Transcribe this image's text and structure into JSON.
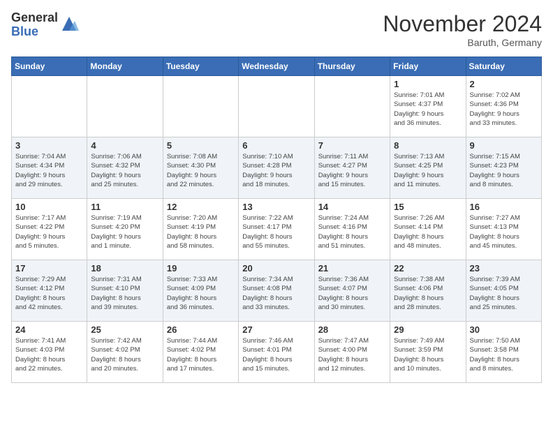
{
  "logo": {
    "general": "General",
    "blue": "Blue"
  },
  "title": "November 2024",
  "location": "Baruth, Germany",
  "days_of_week": [
    "Sunday",
    "Monday",
    "Tuesday",
    "Wednesday",
    "Thursday",
    "Friday",
    "Saturday"
  ],
  "weeks": [
    [
      {
        "day": "",
        "info": ""
      },
      {
        "day": "",
        "info": ""
      },
      {
        "day": "",
        "info": ""
      },
      {
        "day": "",
        "info": ""
      },
      {
        "day": "",
        "info": ""
      },
      {
        "day": "1",
        "info": "Sunrise: 7:01 AM\nSunset: 4:37 PM\nDaylight: 9 hours\nand 36 minutes."
      },
      {
        "day": "2",
        "info": "Sunrise: 7:02 AM\nSunset: 4:36 PM\nDaylight: 9 hours\nand 33 minutes."
      }
    ],
    [
      {
        "day": "3",
        "info": "Sunrise: 7:04 AM\nSunset: 4:34 PM\nDaylight: 9 hours\nand 29 minutes."
      },
      {
        "day": "4",
        "info": "Sunrise: 7:06 AM\nSunset: 4:32 PM\nDaylight: 9 hours\nand 25 minutes."
      },
      {
        "day": "5",
        "info": "Sunrise: 7:08 AM\nSunset: 4:30 PM\nDaylight: 9 hours\nand 22 minutes."
      },
      {
        "day": "6",
        "info": "Sunrise: 7:10 AM\nSunset: 4:28 PM\nDaylight: 9 hours\nand 18 minutes."
      },
      {
        "day": "7",
        "info": "Sunrise: 7:11 AM\nSunset: 4:27 PM\nDaylight: 9 hours\nand 15 minutes."
      },
      {
        "day": "8",
        "info": "Sunrise: 7:13 AM\nSunset: 4:25 PM\nDaylight: 9 hours\nand 11 minutes."
      },
      {
        "day": "9",
        "info": "Sunrise: 7:15 AM\nSunset: 4:23 PM\nDaylight: 9 hours\nand 8 minutes."
      }
    ],
    [
      {
        "day": "10",
        "info": "Sunrise: 7:17 AM\nSunset: 4:22 PM\nDaylight: 9 hours\nand 5 minutes."
      },
      {
        "day": "11",
        "info": "Sunrise: 7:19 AM\nSunset: 4:20 PM\nDaylight: 9 hours\nand 1 minute."
      },
      {
        "day": "12",
        "info": "Sunrise: 7:20 AM\nSunset: 4:19 PM\nDaylight: 8 hours\nand 58 minutes."
      },
      {
        "day": "13",
        "info": "Sunrise: 7:22 AM\nSunset: 4:17 PM\nDaylight: 8 hours\nand 55 minutes."
      },
      {
        "day": "14",
        "info": "Sunrise: 7:24 AM\nSunset: 4:16 PM\nDaylight: 8 hours\nand 51 minutes."
      },
      {
        "day": "15",
        "info": "Sunrise: 7:26 AM\nSunset: 4:14 PM\nDaylight: 8 hours\nand 48 minutes."
      },
      {
        "day": "16",
        "info": "Sunrise: 7:27 AM\nSunset: 4:13 PM\nDaylight: 8 hours\nand 45 minutes."
      }
    ],
    [
      {
        "day": "17",
        "info": "Sunrise: 7:29 AM\nSunset: 4:12 PM\nDaylight: 8 hours\nand 42 minutes."
      },
      {
        "day": "18",
        "info": "Sunrise: 7:31 AM\nSunset: 4:10 PM\nDaylight: 8 hours\nand 39 minutes."
      },
      {
        "day": "19",
        "info": "Sunrise: 7:33 AM\nSunset: 4:09 PM\nDaylight: 8 hours\nand 36 minutes."
      },
      {
        "day": "20",
        "info": "Sunrise: 7:34 AM\nSunset: 4:08 PM\nDaylight: 8 hours\nand 33 minutes."
      },
      {
        "day": "21",
        "info": "Sunrise: 7:36 AM\nSunset: 4:07 PM\nDaylight: 8 hours\nand 30 minutes."
      },
      {
        "day": "22",
        "info": "Sunrise: 7:38 AM\nSunset: 4:06 PM\nDaylight: 8 hours\nand 28 minutes."
      },
      {
        "day": "23",
        "info": "Sunrise: 7:39 AM\nSunset: 4:05 PM\nDaylight: 8 hours\nand 25 minutes."
      }
    ],
    [
      {
        "day": "24",
        "info": "Sunrise: 7:41 AM\nSunset: 4:03 PM\nDaylight: 8 hours\nand 22 minutes."
      },
      {
        "day": "25",
        "info": "Sunrise: 7:42 AM\nSunset: 4:02 PM\nDaylight: 8 hours\nand 20 minutes."
      },
      {
        "day": "26",
        "info": "Sunrise: 7:44 AM\nSunset: 4:02 PM\nDaylight: 8 hours\nand 17 minutes."
      },
      {
        "day": "27",
        "info": "Sunrise: 7:46 AM\nSunset: 4:01 PM\nDaylight: 8 hours\nand 15 minutes."
      },
      {
        "day": "28",
        "info": "Sunrise: 7:47 AM\nSunset: 4:00 PM\nDaylight: 8 hours\nand 12 minutes."
      },
      {
        "day": "29",
        "info": "Sunrise: 7:49 AM\nSunset: 3:59 PM\nDaylight: 8 hours\nand 10 minutes."
      },
      {
        "day": "30",
        "info": "Sunrise: 7:50 AM\nSunset: 3:58 PM\nDaylight: 8 hours\nand 8 minutes."
      }
    ]
  ]
}
